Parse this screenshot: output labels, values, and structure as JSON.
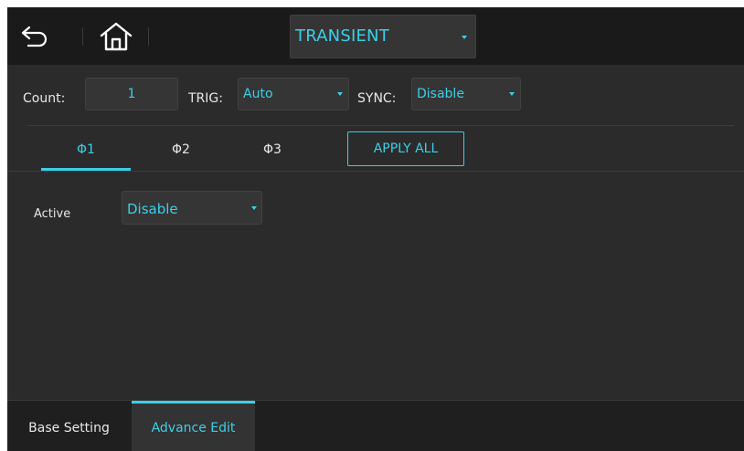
{
  "header": {
    "back_icon": "back-arrow-icon",
    "home_icon": "home-icon",
    "mode_select": {
      "value": "TRANSIENT",
      "icon": "caret-down-icon"
    }
  },
  "params": {
    "count": {
      "label": "Count:",
      "value": "1"
    },
    "trig": {
      "label": "TRIG:",
      "value": "Auto"
    },
    "sync": {
      "label": "SYNC:",
      "value": "Disable"
    }
  },
  "phases": {
    "tabs": [
      {
        "label": "Φ1",
        "active": true
      },
      {
        "label": "Φ2",
        "active": false
      },
      {
        "label": "Φ3",
        "active": false
      }
    ],
    "apply_all_label": "APPLY ALL"
  },
  "active_row": {
    "label": "Active",
    "value": "Disable"
  },
  "bottom_tabs": [
    {
      "label": "Base Setting",
      "active": false
    },
    {
      "label": "Advance Edit",
      "active": true
    }
  ],
  "colors": {
    "accent": "#3ad0e8",
    "background": "#2b2b2b",
    "header": "#1a1a1a",
    "field": "#353535"
  }
}
